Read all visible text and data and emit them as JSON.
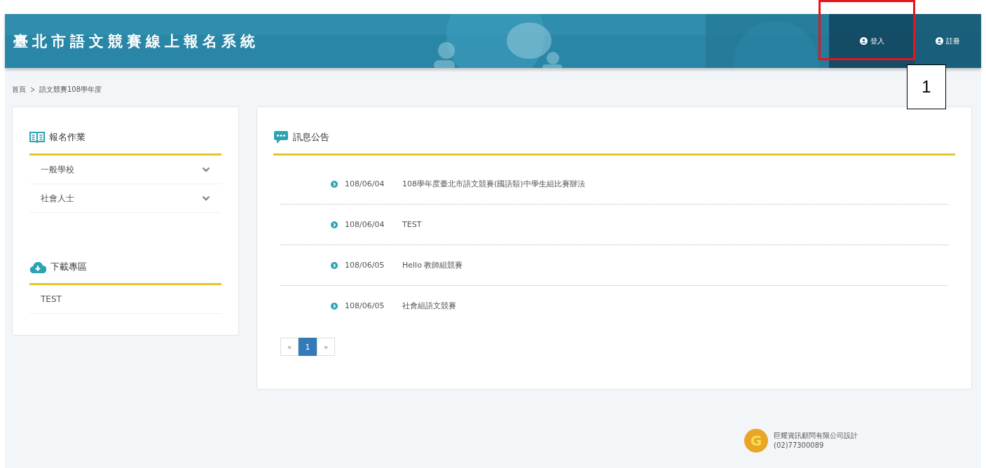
{
  "header": {
    "title": "臺北市語文競賽線上報名系統",
    "nav": [
      {
        "label": "登入",
        "selected": true
      },
      {
        "label": "註冊",
        "selected": false
      }
    ]
  },
  "annotation": {
    "label": "1"
  },
  "breadcrumb": [
    "首頁",
    "語文競賽108學年度"
  ],
  "sidebar": [
    {
      "kind": "menu",
      "heading": "報名作業",
      "items": [
        {
          "label": "一般學校",
          "expanded": false
        },
        {
          "label": "社會人士",
          "expanded": false
        }
      ]
    },
    {
      "kind": "download",
      "heading": "下載專區",
      "items": [
        {
          "label": "TEST"
        }
      ]
    }
  ],
  "news": {
    "heading": "訊息公告",
    "items": [
      {
        "date": "108/06/04",
        "title": "108學年度臺北市語文競賽(國語類)中學生組比賽辦法"
      },
      {
        "date": "108/06/04",
        "title": "TEST"
      },
      {
        "date": "108/06/05",
        "title": "Hello 教師組競賽"
      },
      {
        "date": "108/06/05",
        "title": "社會組語文競賽"
      }
    ],
    "pagination": [
      {
        "label": "«",
        "selected": false
      },
      {
        "label": "1",
        "selected": true
      },
      {
        "label": "»",
        "selected": false
      }
    ]
  },
  "footer": {
    "logo": "G",
    "company": "巨耀資訊顧問有限公司設計",
    "phone": "(02)77300089"
  }
}
